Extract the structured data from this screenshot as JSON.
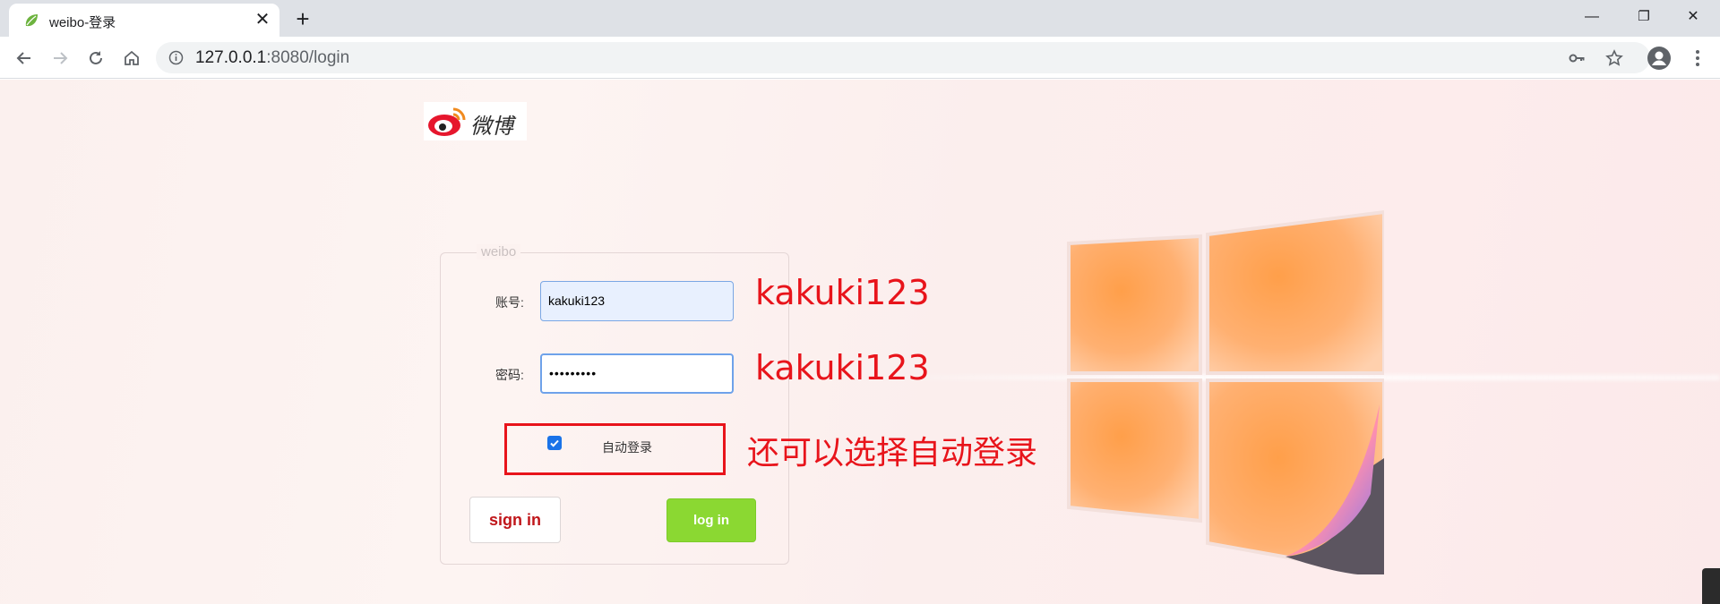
{
  "browser": {
    "tab_title": "weibo-登录",
    "url_host": "127.0.0.1",
    "url_rest": ":8080/login",
    "tab_close": "✕",
    "new_tab": "+",
    "minimize": "—",
    "restore": "❐",
    "close": "✕"
  },
  "logo": {
    "text": "微博"
  },
  "form": {
    "legend": "weibo",
    "username_label": "账号:",
    "username_value": "kakuki123",
    "password_label": "密码:",
    "password_mask": "•••••••••",
    "auto_login_label": "自动登录",
    "auto_login_checked": true,
    "signin_label": "sign in",
    "login_label": "log in"
  },
  "annotations": {
    "username_note": "kakuki123",
    "password_note": "kakuki123",
    "auto_login_note": "还可以选择自动登录"
  },
  "colors": {
    "annotation": "#e8141b",
    "login_button": "#8bd832",
    "signin_text": "#c0161a"
  },
  "icons": [
    "spring-leaf-icon",
    "back-icon",
    "forward-icon",
    "reload-icon",
    "home-icon",
    "info-icon",
    "key-icon",
    "star-icon",
    "profile-icon",
    "menu-icon",
    "weibo-logo-icon",
    "windows-logo-icon"
  ]
}
